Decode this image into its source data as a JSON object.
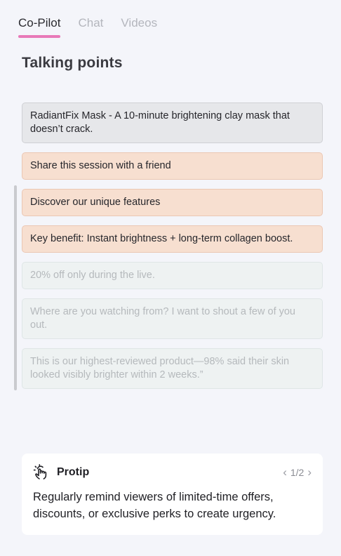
{
  "tabs": [
    {
      "label": "Co-Pilot"
    },
    {
      "label": "Chat"
    },
    {
      "label": "Videos"
    }
  ],
  "section_title": "Talking points",
  "talking_points": [
    {
      "text": "RadiantFix Mask - A 10-minute brightening clay mask that doesn’t crack.",
      "style": "gray"
    },
    {
      "text": "Share this session with a friend",
      "style": "peach"
    },
    {
      "text": "Discover our unique features",
      "style": "peach"
    },
    {
      "text": "Key benefit: Instant brightness + long-term collagen boost.",
      "style": "peach"
    },
    {
      "text": "20% off only during the live.",
      "style": "faded"
    },
    {
      "text": "Where are you watching from? I want to shout a few of you out.",
      "style": "faded"
    },
    {
      "text": "This is our highest-reviewed product—98% said their skin looked visibly brighter within 2 weeks.”",
      "style": "faded"
    }
  ],
  "protip": {
    "icon": "tap-gesture-icon",
    "title": "Protip",
    "pager": "1/2",
    "body": "Regularly remind viewers of limited-time offers, discounts, or exclusive perks to create urgency."
  },
  "colors": {
    "accent": "#e879b8",
    "peach": "#f7dfd0",
    "gray": "#e6e7ea",
    "faded": "#eef2f2",
    "background": "#f4f5fa"
  }
}
